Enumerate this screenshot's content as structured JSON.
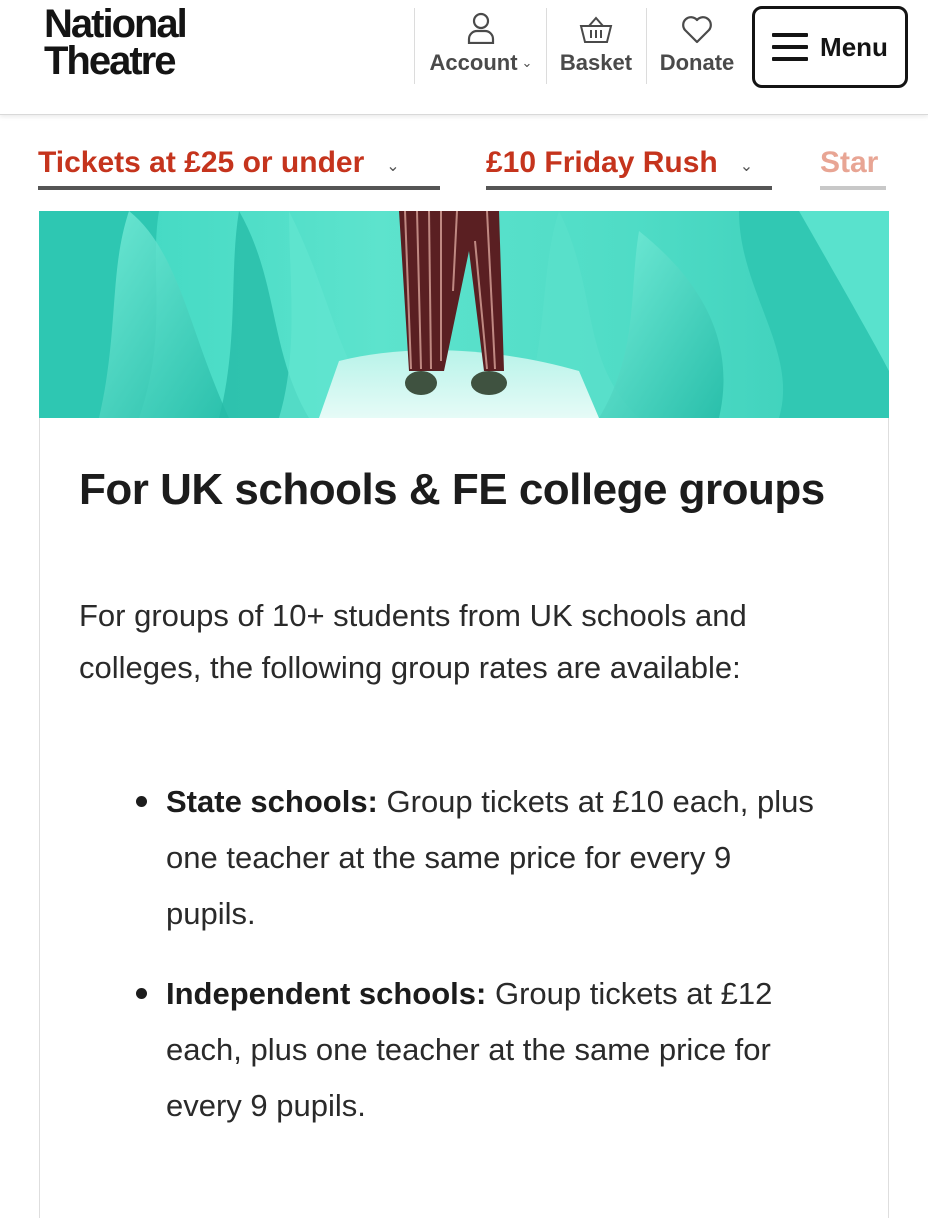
{
  "header": {
    "logo": {
      "line1": "National",
      "line2": "Theatre"
    },
    "account_label": "Account",
    "basket_label": "Basket",
    "donate_label": "Donate",
    "menu_label": "Menu"
  },
  "subnav": {
    "items": [
      {
        "label": "Tickets at £25 or under"
      },
      {
        "label": "£10 Friday Rush"
      },
      {
        "label": "Star"
      }
    ]
  },
  "card": {
    "title": "For UK schools & FE college groups",
    "intro": "For groups of 10+ students from UK schools and colleges, the following group rates are available:",
    "rates": [
      {
        "label": "State schools:",
        "text": " Group tickets at £10 each, plus one teacher at the same price for every 9 pupils."
      },
      {
        "label": "Independent schools:",
        "text": " Group tickets at £12 each, plus one teacher at the same price for every 9 pupils."
      }
    ]
  },
  "colors": {
    "accent_red": "#c5341d",
    "hero_teal": "#4fdcc6",
    "text_dark": "#1c1c1c"
  },
  "icons": [
    "account-icon",
    "basket-icon",
    "heart-icon",
    "hamburger-icon",
    "chevron-down-icon"
  ]
}
